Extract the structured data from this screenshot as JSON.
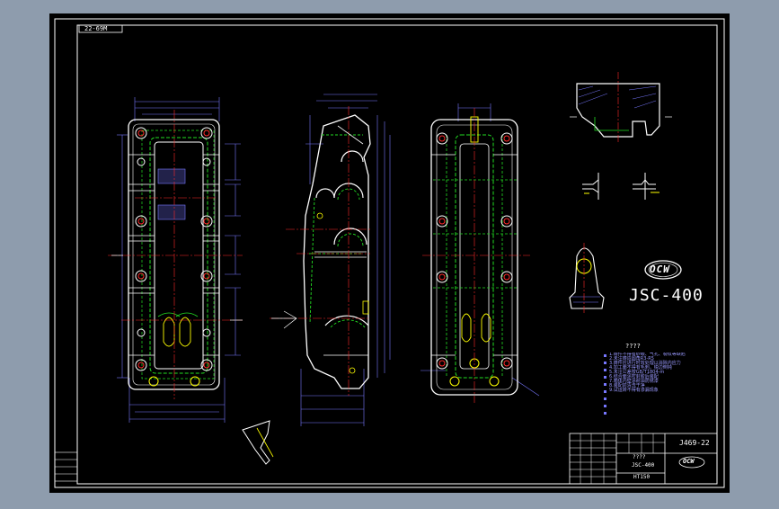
{
  "drawing": {
    "title_tag": "22-69M",
    "logo_text": "OCW",
    "model": "JSC-400",
    "notes_title": "????",
    "notes_lines": [
      "1.铸件不得有砂眼、气孔、裂纹等缺陷",
      "2.未注铸造圆角R3-R5",
      "3.铸件应进行时效处理以消除内应力",
      "4.加工面不得有毛刺，锐边倒钝",
      "5.未注公差按GB/T1804-m",
      "6.结合面涂密封胶后装配",
      "7.箱体内壁涂耐油防锈漆",
      "8.装配前清洗干净",
      "9.试运转不得有渗漏现象"
    ],
    "title_block": {
      "drawing_no": "J469-22",
      "name": "????",
      "model": "JSC-400",
      "material": "HT150",
      "logo": "OCW"
    }
  },
  "colors": {
    "background": "#8e9cad",
    "sheet": "#000000",
    "line": "#ffffff",
    "centerline": "#ff2a2a",
    "hidden": "#22dd22",
    "dimension": "#7777ff",
    "highlight": "#ffff00"
  }
}
